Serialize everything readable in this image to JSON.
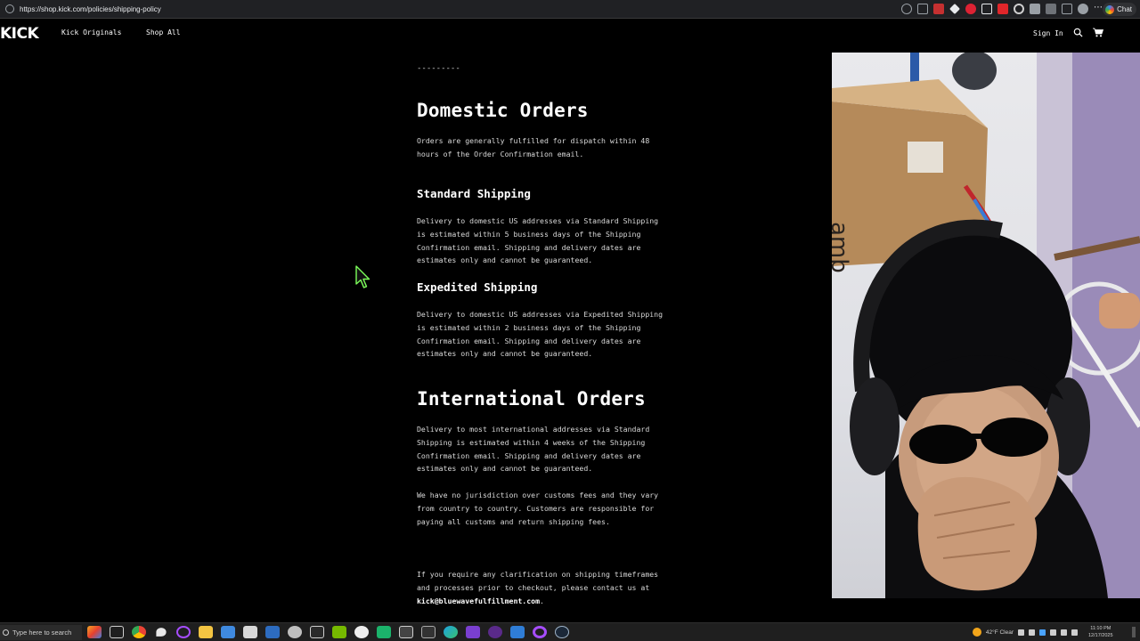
{
  "browser": {
    "url": "https://shop.kick.com/policies/shipping-policy",
    "chat_label": "Chat"
  },
  "header": {
    "logo": "KICK",
    "nav": [
      "Kick Originals",
      "Shop All"
    ],
    "sign_in": "Sign In"
  },
  "content": {
    "divider": "---------",
    "domestic_title": "Domestic Orders",
    "domestic_body": "Orders are generally fulfilled for dispatch within 48\nhours of the Order Confirmation email.",
    "standard_title": "Standard Shipping",
    "standard_body": "Delivery to domestic US addresses via Standard Shipping\nis estimated within 5 business days of the Shipping\nConfirmation email. Shipping and delivery dates are\nestimates only and cannot be guaranteed.",
    "expedited_title": "Expedited Shipping",
    "expedited_body": "Delivery to domestic US addresses via Expedited Shipping\nis estimated within 2 business days of the Shipping\nConfirmation email. Shipping and delivery dates are\nestimates only and cannot be guaranteed.",
    "international_title": "International Orders",
    "international_body": "Delivery to most international addresses via Standard\nShipping is estimated within 4 weeks of the Shipping\nConfirmation email. Shipping and delivery dates are\nestimates only and cannot be guaranteed.",
    "customs_body": "We have no jurisdiction over customs fees and they vary\nfrom country to country. Customers are responsible for\npaying all customs and return shipping fees.",
    "contact_body": "If you require any clarification on shipping timeframes\nand processes prior to checkout, please contact us at",
    "contact_email": "kick@bluewavefulfillment.com",
    "contact_end": "."
  },
  "taskbar": {
    "search_placeholder": "Type here to search",
    "weather": "42°F  Clear",
    "time": "11:10 PM",
    "date": "12/17/2025"
  },
  "colors": {
    "page_bg": "#000000",
    "text": "#ffffff",
    "body_text": "#d9d9d9",
    "browser_bar": "#202124",
    "taskbar": "#1f1f1f"
  }
}
